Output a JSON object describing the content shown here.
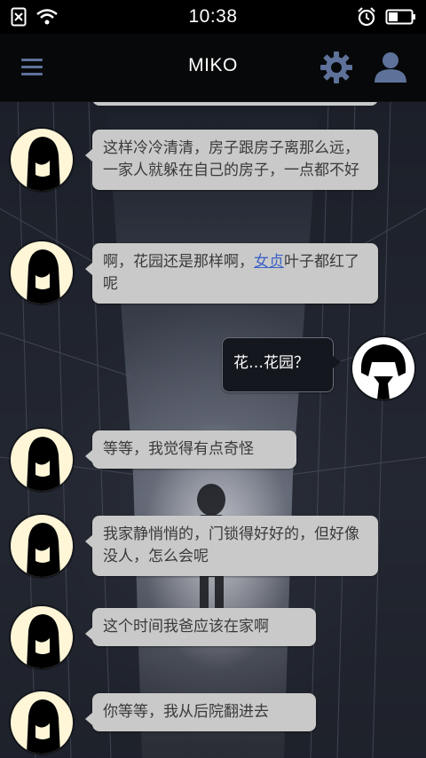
{
  "status_bar": {
    "time": "10:38",
    "icons": [
      "sim-off-icon",
      "wifi-icon",
      "alarm-icon",
      "battery-icon"
    ]
  },
  "header": {
    "title": "MIKO",
    "menu_icon": "hamburger-menu-icon",
    "settings_icon": "gear-icon",
    "profile_icon": "user-icon",
    "accent_color": "#5d7199"
  },
  "messages": [
    {
      "side": "left",
      "text": "这样冷冷清清，房子跟房子离那么远，一家人就躲在自己的房子，一点都不好"
    },
    {
      "side": "left",
      "text_before": "啊，花园还是那样啊，",
      "link": "女贞",
      "text_after": "叶子都红了呢"
    },
    {
      "side": "right",
      "text": "花…花园？"
    },
    {
      "side": "left",
      "text": "等等，我觉得有点奇怪"
    },
    {
      "side": "left",
      "text": "我家静悄悄的，门锁得好好的，但好像没人，怎么会呢"
    },
    {
      "side": "left",
      "text": "这个时间我爸应该在家啊"
    },
    {
      "side": "left",
      "text": "你等等，我从后院翻进去"
    }
  ]
}
